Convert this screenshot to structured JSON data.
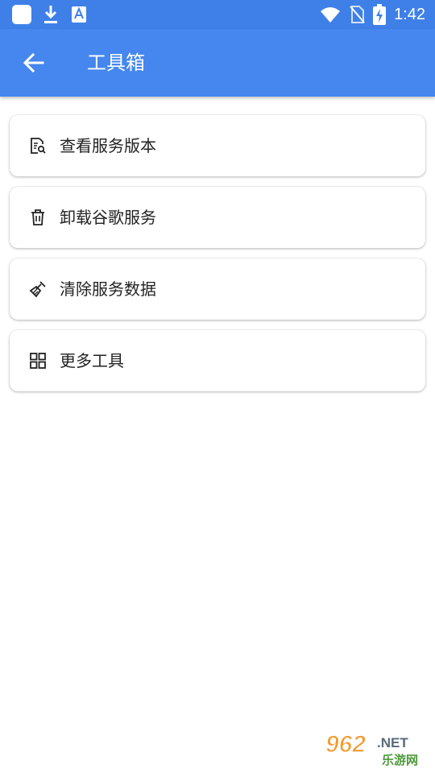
{
  "status_bar": {
    "time": "1:42",
    "bg_color": "#3f80e8"
  },
  "app_bar": {
    "title": "工具箱",
    "back_icon": "arrow-left-icon",
    "bg_color": "#4587ee"
  },
  "menu": {
    "items": [
      {
        "label": "查看服务版本",
        "icon": "document-search-icon"
      },
      {
        "label": "卸载谷歌服务",
        "icon": "trash-icon"
      },
      {
        "label": "清除服务数据",
        "icon": "broom-icon"
      },
      {
        "label": "更多工具",
        "icon": "grid-icon"
      }
    ]
  },
  "watermark": {
    "text_top": "962",
    "text_net": ".NET",
    "text_bottom": "乐游网"
  }
}
